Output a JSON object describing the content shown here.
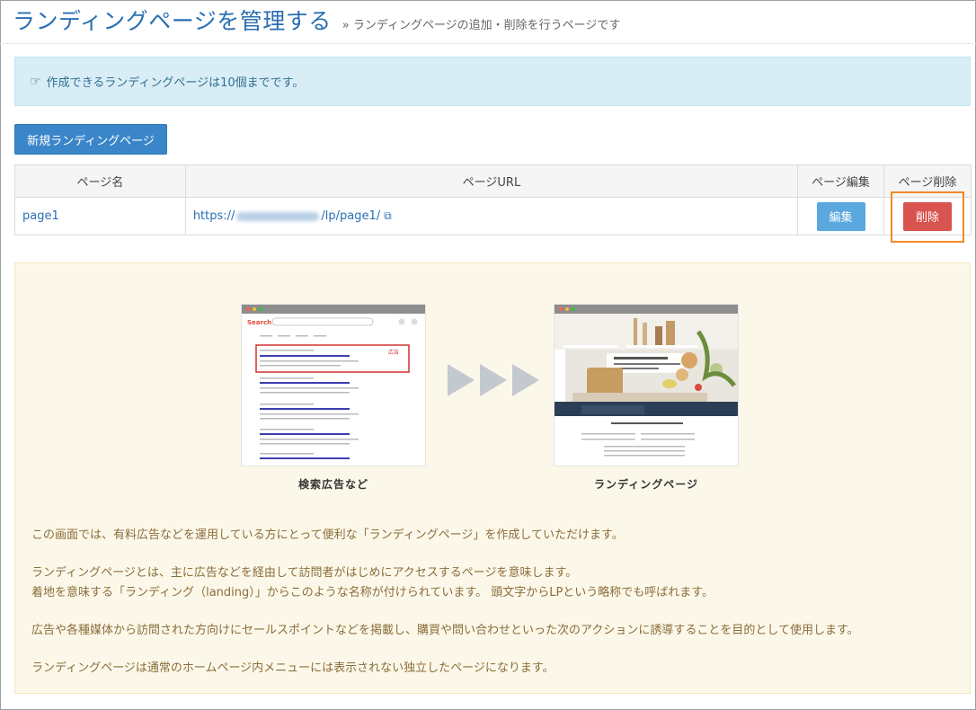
{
  "header": {
    "title": "ランディングページを管理する",
    "subtitle": "» ランディングページの追加・削除を行うページです"
  },
  "info": {
    "icon": "hand-point-right-icon",
    "text": "作成できるランディングページは10個までです。"
  },
  "actions": {
    "new_label": "新規ランディングページ"
  },
  "table": {
    "headers": [
      "ページ名",
      "ページURL",
      "ページ編集",
      "ページ削除"
    ],
    "rows": [
      {
        "name": "page1",
        "url_prefix": "https://",
        "url_suffix": "/lp/page1/",
        "edit_label": "編集",
        "delete_label": "削除"
      }
    ]
  },
  "illustration": {
    "left_caption": "検索広告など",
    "right_caption": "ランディングページ",
    "search_logo": "Search",
    "ad_label": "広告"
  },
  "explanation": {
    "p1": "この画面では、有料広告などを運用している方にとって便利な「ランディングページ」を作成していただけます。",
    "p2a": "ランディングページとは、主に広告などを経由して訪問者がはじめにアクセスするページを意味します。",
    "p2b": "着地を意味する「ランディング（landing）」からこのような名称が付けられています。 頭文字からLPという略称でも呼ばれます。",
    "p3": "広告や各種媒体から訪問された方向けにセールスポイントなどを掲載し、購買や問い合わせといった次のアクションに誘導することを目的として使用します。",
    "p4": "ランディングページは通常のホームページ内メニューには表示されない独立したページになります。"
  },
  "colors": {
    "title": "#2a6fb1",
    "info_bg": "#d9edf7",
    "primary": "#3a86c8",
    "danger": "#d9534f",
    "highlight": "#f08a24",
    "explain_bg": "#fcf8e9"
  }
}
